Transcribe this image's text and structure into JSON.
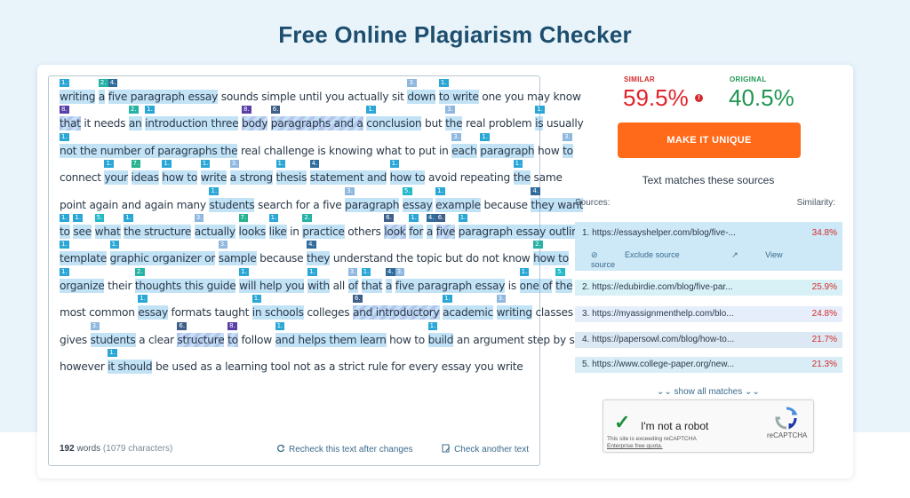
{
  "page": {
    "title": "Free Online Plagiarism Checker"
  },
  "text_lines": [
    [
      [
        "writing",
        "1."
      ],
      [
        " "
      ],
      [
        "a",
        "2."
      ],
      [
        " "
      ],
      [
        "five paragraph essay",
        "4."
      ],
      [
        " sounds simple until you actually sit "
      ],
      [
        "down",
        "3."
      ],
      [
        " "
      ],
      [
        "to write",
        "1."
      ],
      [
        " one you may know"
      ]
    ],
    [
      [
        "that",
        "8."
      ],
      [
        " it needs "
      ],
      [
        "an",
        "2."
      ],
      [
        " "
      ],
      [
        "introduction three",
        "1."
      ],
      [
        " "
      ],
      [
        "body",
        "8."
      ],
      [
        " "
      ],
      [
        "paragraphs and a",
        "6."
      ],
      [
        " "
      ],
      [
        "conclusion",
        "1."
      ],
      [
        " but "
      ],
      [
        "the",
        "3."
      ],
      [
        " real problem "
      ],
      [
        "is",
        "1."
      ],
      [
        " usually"
      ]
    ],
    [
      [
        "not the number of paragraphs the",
        "1."
      ],
      [
        " real challenge is knowing what to put in "
      ],
      [
        "each",
        "3."
      ],
      [
        " "
      ],
      [
        "paragraph",
        "1."
      ],
      [
        " how "
      ],
      [
        "to",
        "3."
      ]
    ],
    [
      [
        "connect "
      ],
      [
        "your",
        "1."
      ],
      [
        " "
      ],
      [
        "ideas",
        "7."
      ],
      [
        " "
      ],
      [
        "how to",
        "1."
      ],
      [
        " "
      ],
      [
        "write",
        "1."
      ],
      [
        " "
      ],
      [
        "a strong",
        "3."
      ],
      [
        " "
      ],
      [
        "thesis",
        "1."
      ],
      [
        " "
      ],
      [
        "statement and",
        "4."
      ],
      [
        " "
      ],
      [
        "how to",
        "1."
      ],
      [
        " avoid repeating "
      ],
      [
        "the",
        "1."
      ],
      [
        " same"
      ]
    ],
    [
      [
        "point again and again many "
      ],
      [
        "students",
        "1."
      ],
      [
        " search for a five "
      ],
      [
        "paragraph",
        "3."
      ],
      [
        " "
      ],
      [
        "essay",
        "5."
      ],
      [
        " "
      ],
      [
        "example",
        "1."
      ],
      [
        " because "
      ],
      [
        "they want",
        "4."
      ]
    ],
    [
      [
        "to",
        "1."
      ],
      [
        " "
      ],
      [
        "see",
        "1."
      ],
      [
        " "
      ],
      [
        "what",
        "5."
      ],
      [
        " "
      ],
      [
        "the structure",
        "1."
      ],
      [
        " "
      ],
      [
        "actually",
        "3."
      ],
      [
        " "
      ],
      [
        "looks",
        "7."
      ],
      [
        " "
      ],
      [
        "like",
        "1."
      ],
      [
        " in "
      ],
      [
        "practice",
        "2."
      ],
      [
        " others "
      ],
      [
        "look",
        "6."
      ],
      [
        " "
      ],
      [
        "for",
        "1."
      ],
      [
        " "
      ],
      [
        "a",
        "4."
      ],
      [
        " "
      ],
      [
        "five",
        "6."
      ],
      [
        " "
      ],
      [
        "paragraph essay outline",
        "1."
      ]
    ],
    [
      [
        "template",
        "1."
      ],
      [
        " "
      ],
      [
        "graphic organizer or",
        "1."
      ],
      [
        " "
      ],
      [
        "sample",
        "3."
      ],
      [
        " because "
      ],
      [
        "they",
        "4."
      ],
      [
        " understand the topic but do not know "
      ],
      [
        "how to",
        "2."
      ]
    ],
    [
      [
        "organize",
        "1."
      ],
      [
        " their "
      ],
      [
        "thoughts this guide",
        "2."
      ],
      [
        " "
      ],
      [
        "will help you",
        "1."
      ],
      [
        " "
      ],
      [
        "with",
        "1."
      ],
      [
        " all "
      ],
      [
        "of",
        "3."
      ],
      [
        " "
      ],
      [
        "that",
        "1."
      ],
      [
        " "
      ],
      [
        "a",
        "4."
      ],
      [
        " "
      ],
      [
        "five paragraph essay",
        "3."
      ],
      [
        " is "
      ],
      [
        "one of",
        "1."
      ],
      [
        " "
      ],
      [
        "the",
        "5."
      ]
    ],
    [
      [
        "most common "
      ],
      [
        "essay",
        "1."
      ],
      [
        " formats taught "
      ],
      [
        "in schools",
        "1."
      ],
      [
        " colleges "
      ],
      [
        "and introductory",
        "6."
      ],
      [
        " "
      ],
      [
        "academic",
        "1."
      ],
      [
        " "
      ],
      [
        "writing",
        "3."
      ],
      [
        " classes it"
      ]
    ],
    [
      [
        "gives "
      ],
      [
        "students",
        "3."
      ],
      [
        " a clear "
      ],
      [
        "structure",
        "6."
      ],
      [
        " "
      ],
      [
        "to",
        "8."
      ],
      [
        " follow "
      ],
      [
        "and helps them learn",
        "1."
      ],
      [
        " how to "
      ],
      [
        "build",
        "1."
      ],
      [
        " an argument step by step"
      ]
    ],
    [
      [
        "however "
      ],
      [
        "it should",
        "1."
      ],
      [
        " be used as a learning tool not as a strict rule for every essay you write"
      ]
    ]
  ],
  "footer": {
    "words": "192",
    "words_label": " words ",
    "chars": "(1079 characters)",
    "recheck": "Recheck this text after changes",
    "check_another": "Check another text"
  },
  "results": {
    "similar_label": "SIMILAR",
    "similar_value": "59.5%",
    "original_label": "ORIGINAL",
    "original_value": "40.5%",
    "make_unique": "MAKE IT UNIQUE",
    "matches_title": "Text matches these sources",
    "sources_header": "Sources:",
    "similarity_header": "Similarity:",
    "exclude_source": "Exclude source",
    "view_source": "View source",
    "show_all": "show all matches",
    "sources": [
      {
        "label": "1.  https://essayshelper.com/blog/five-...",
        "pct": "34.8%"
      },
      {
        "label": "2.  https://edubirdie.com/blog/five-par...",
        "pct": "25.9%"
      },
      {
        "label": "3.  https://myassignmenthelp.com/blo...",
        "pct": "24.8%"
      },
      {
        "label": "4.  https://papersowl.com/blog/how-to...",
        "pct": "21.7%"
      },
      {
        "label": "5.  https://www.college-paper.org/new...",
        "pct": "21.3%"
      }
    ]
  },
  "recaptcha": {
    "label": "I'm not a robot",
    "note1": "This site is exceeding reCAPTCHA",
    "note2": "Enterprise free quota.",
    "brand": "reCAPTCHA"
  },
  "colors": {
    "similar": "#e0242a",
    "original": "#219653",
    "cta": "#ff6a1a",
    "title": "#1d4e6e"
  }
}
